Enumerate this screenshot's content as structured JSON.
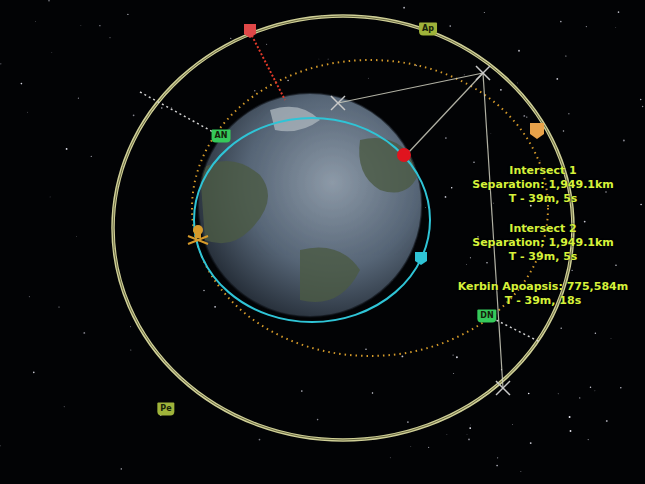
{
  "markers": [
    {
      "label": "Ap",
      "kind": "apoapsis",
      "color": "#9fb33a"
    },
    {
      "label": "Pe",
      "kind": "periapsis",
      "color": "#9fb33a"
    },
    {
      "label": "AN",
      "kind": "node",
      "color": "#35c95a"
    },
    {
      "label": "DN",
      "kind": "node",
      "color": "#35c95a"
    }
  ],
  "intersects": [
    {
      "title": "Intersect 1",
      "separation": "Separation: 1,949.1km",
      "time": "T - 39m, 5s"
    },
    {
      "title": "Intersect 2",
      "separation": "Separation: 1,949.1km",
      "time": "T - 39m, 5s"
    }
  ],
  "apoapsis": {
    "label": "Kerbin Apoapsis: 775,584m",
    "time": "T - 39m, 18s"
  }
}
